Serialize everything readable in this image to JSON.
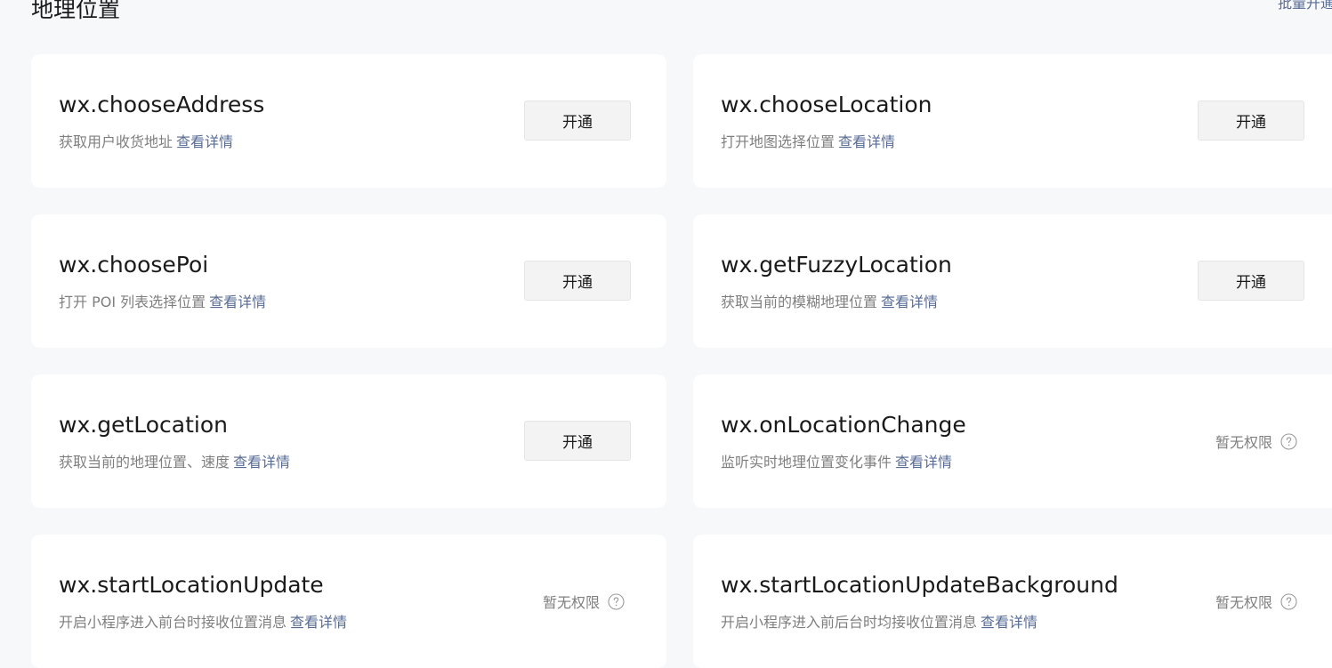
{
  "section": {
    "title": "地理位置",
    "batch_link": "批量开通"
  },
  "detail_label": "查看详情",
  "enable_label": "开通",
  "no_permission_label": "暂无权限",
  "apis": [
    {
      "name": "wx.chooseAddress",
      "desc": "获取用户收货地址",
      "action": "enable"
    },
    {
      "name": "wx.chooseLocation",
      "desc": "打开地图选择位置",
      "action": "enable"
    },
    {
      "name": "wx.choosePoi",
      "desc": "打开 POI 列表选择位置",
      "action": "enable"
    },
    {
      "name": "wx.getFuzzyLocation",
      "desc": "获取当前的模糊地理位置",
      "action": "enable"
    },
    {
      "name": "wx.getLocation",
      "desc": "获取当前的地理位置、速度",
      "action": "enable"
    },
    {
      "name": "wx.onLocationChange",
      "desc": "监听实时地理位置变化事件",
      "action": "no_permission"
    },
    {
      "name": "wx.startLocationUpdate",
      "desc": "开启小程序进入前台时接收位置消息",
      "action": "no_permission"
    },
    {
      "name": "wx.startLocationUpdateBackground",
      "desc": "开启小程序进入前后台时均接收位置消息",
      "action": "no_permission"
    }
  ],
  "colors": {
    "page_background": "#f7f8fa",
    "card_background": "#ffffff",
    "link": "#576b95",
    "secondary_text": "#7f7f7f",
    "button_background": "#f3f3f3"
  },
  "icons": {
    "help": "question-circle-icon"
  }
}
